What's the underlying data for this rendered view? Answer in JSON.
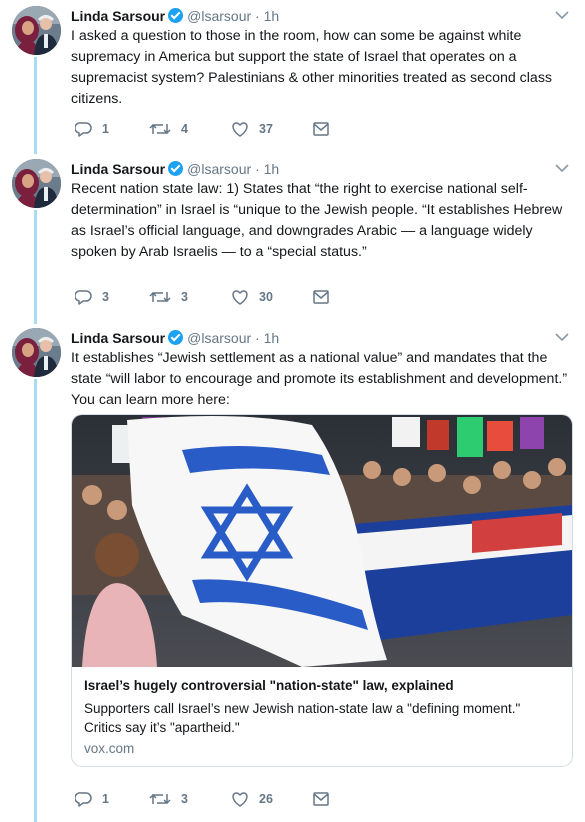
{
  "author": {
    "name": "Linda Sarsour",
    "handle": "@lsarsour",
    "separator": "·"
  },
  "tweets": [
    {
      "time": "1h",
      "text": "I asked a question to those in the room, how can some be against white supremacy in America but support the state of Israel that operates on a supremacist system? Palestinians & other minorities treated as second class citizens.",
      "replies": "1",
      "retweets": "4",
      "likes": "37"
    },
    {
      "time": "1h",
      "text": "Recent nation state law: 1) States that “the right to exercise national self-determination” in Israel is “unique to the Jewish people. “It establishes Hebrew as Israel’s official language, and downgrades Arabic — a language widely spoken by Arab Israelis — to a “special status.”",
      "replies": "3",
      "retweets": "3",
      "likes": "30"
    },
    {
      "time": "1h",
      "text": "It establishes “Jewish settlement as a national value” and mandates that the state “will labor to encourage and promote its establishment and development.” You can learn more here:",
      "replies": "1",
      "retweets": "3",
      "likes": "26",
      "card": {
        "title": "Israel’s hugely controversial \"nation-state\" law, explained",
        "description": "Supporters call Israel’s new Jewish nation-state law a \"defining moment.\" Critics say it’s \"apartheid.\"",
        "domain": "vox.com"
      }
    }
  ],
  "colors": {
    "thread_line": "#a8dcf5",
    "verified": "#1da1f2",
    "muted": "#657786",
    "icon": "#657786"
  },
  "icons": [
    "avatar",
    "verified-badge-icon",
    "chevron-down-icon",
    "reply-icon",
    "retweet-icon",
    "like-icon",
    "message-icon"
  ]
}
